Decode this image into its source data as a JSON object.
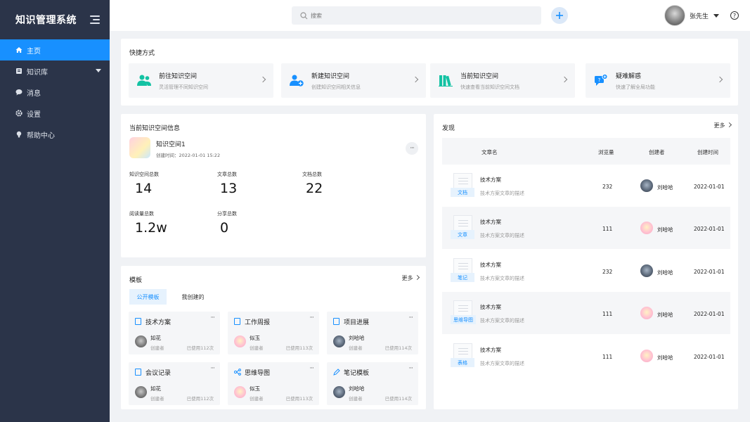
{
  "app": {
    "title": "知识管理系统"
  },
  "sidebar": {
    "items": [
      {
        "label": "主页",
        "icon": "home-icon",
        "active": true
      },
      {
        "label": "知识库",
        "icon": "book-icon",
        "active": false,
        "has_submenu": true
      },
      {
        "label": "消息",
        "icon": "message-icon",
        "active": false
      },
      {
        "label": "设置",
        "icon": "gear-icon",
        "active": false
      },
      {
        "label": "帮助中心",
        "icon": "lightbulb-icon",
        "active": false
      }
    ]
  },
  "header": {
    "search_placeholder": "搜索",
    "user_name": "张先生",
    "help_symbol": "?"
  },
  "shortcuts": {
    "title": "快捷方式",
    "items": [
      {
        "title": "前往知识空间",
        "subtitle": "灵活管理不同知识空间",
        "icon": "users-icon",
        "color": "#13c2a3"
      },
      {
        "title": "新建知识空间",
        "subtitle": "创建知识空间相关信息",
        "icon": "add-user-icon",
        "color": "#1890ff"
      },
      {
        "title": "当前知识空间",
        "subtitle": "快速查看当前知识空间文档",
        "icon": "books-icon",
        "color": "#13c2a3"
      },
      {
        "title": "疑难解惑",
        "subtitle": "快速了解全局功能",
        "icon": "chat-help-icon",
        "color": "#1890ff"
      }
    ]
  },
  "space_info": {
    "title": "当前知识空间信息",
    "name": "知识空间1",
    "created": "创建时间：2022-01-01 15:22",
    "more_symbol": "···",
    "stats": [
      {
        "label": "知识空间总数",
        "value": "14"
      },
      {
        "label": "文章总数",
        "value": "13"
      },
      {
        "label": "文档总数",
        "value": "22"
      },
      {
        "label": "阅读量总数",
        "value": "1.2w"
      },
      {
        "label": "分享总数",
        "value": "0"
      }
    ]
  },
  "templates": {
    "title": "模板",
    "more": "更多",
    "tabs": [
      {
        "label": "公开模板",
        "active": true
      },
      {
        "label": "我创建的",
        "active": false
      }
    ],
    "cards": [
      {
        "name": "技术方案",
        "author": "如花",
        "role": "创建者",
        "used": "已使用112次",
        "avatar": "gray",
        "icon": "doc-icon"
      },
      {
        "name": "工作周报",
        "author": "似玉",
        "role": "创建者",
        "used": "已使用113次",
        "avatar": "pink",
        "icon": "doc-icon"
      },
      {
        "name": "项目进展",
        "author": "刘哈哈",
        "role": "创建者",
        "used": "已使用114次",
        "avatar": "dark",
        "icon": "doc-icon"
      },
      {
        "name": "会议记录",
        "author": "如花",
        "role": "创建者",
        "used": "已使用112次",
        "avatar": "gray",
        "icon": "doc-icon"
      },
      {
        "name": "思维导图",
        "author": "似玉",
        "role": "创建者",
        "used": "已使用113次",
        "avatar": "pink",
        "icon": "mindmap-icon"
      },
      {
        "name": "笔记模板",
        "author": "刘哈哈",
        "role": "创建者",
        "used": "已使用114次",
        "avatar": "dark",
        "icon": "pen-icon"
      }
    ],
    "dots": "···"
  },
  "discovery": {
    "title": "发现",
    "more": "更多",
    "columns": [
      "文章名",
      "浏览量",
      "创建者",
      "创建时间"
    ],
    "rows": [
      {
        "title": "技术方案",
        "desc": "技术方案文章的描述",
        "tag": "文档",
        "views": "232",
        "author": "刘哈哈",
        "avatar": "dark",
        "date": "2022-01-01"
      },
      {
        "title": "技术方案",
        "desc": "技术方案文章的描述",
        "tag": "文章",
        "views": "111",
        "author": "刘哈哈",
        "avatar": "pink",
        "date": "2022-01-01"
      },
      {
        "title": "技术方案",
        "desc": "技术方案文章的描述",
        "tag": "笔记",
        "views": "232",
        "author": "刘哈哈",
        "avatar": "dark",
        "date": "2022-01-01"
      },
      {
        "title": "技术方案",
        "desc": "技术方案文章的描述",
        "tag": "思维导图",
        "views": "111",
        "author": "刘哈哈",
        "avatar": "pink",
        "date": "2022-01-01"
      },
      {
        "title": "技术方案",
        "desc": "技术方案文章的描述",
        "tag": "表格",
        "views": "111",
        "author": "刘哈哈",
        "avatar": "pink",
        "date": "2022-01-01"
      }
    ]
  },
  "colors": {
    "sidebar_bg": "#2b3449",
    "accent": "#1890ff",
    "teal": "#13c2a3"
  }
}
